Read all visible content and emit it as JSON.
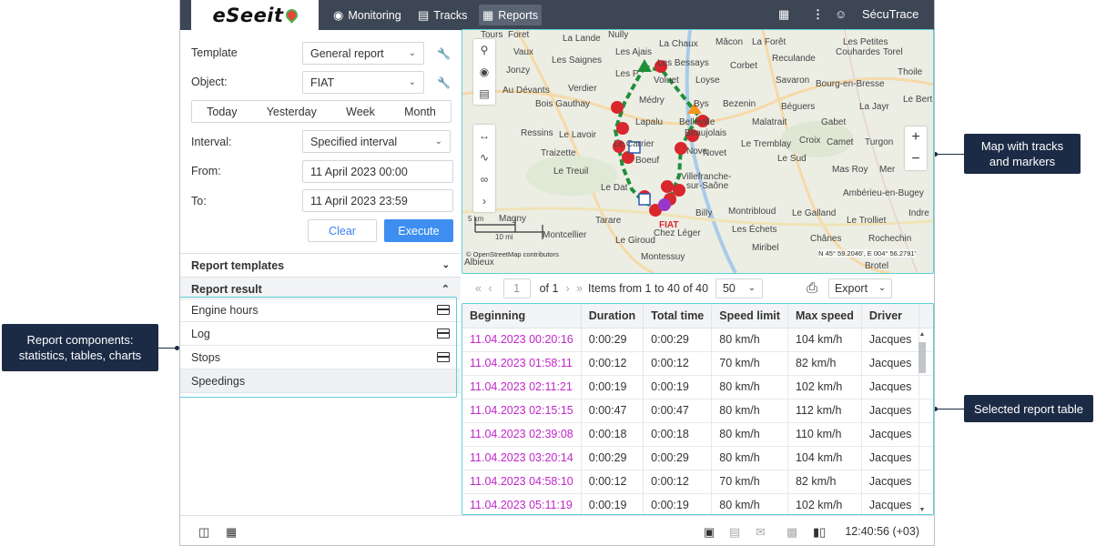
{
  "callouts": {
    "left": "Report components: statistics, tables, charts",
    "map": "Map with tracks and markers",
    "table": "Selected report table"
  },
  "topbar": {
    "logo": "eSeeit",
    "nav": [
      {
        "label": "Monitoring",
        "icon": "globe-icon"
      },
      {
        "label": "Tracks",
        "icon": "tracks-icon"
      },
      {
        "label": "Reports",
        "icon": "reports-icon",
        "active": true
      }
    ],
    "user": "SécuTrace"
  },
  "form": {
    "template_label": "Template",
    "template_value": "General report",
    "object_label": "Object:",
    "object_value": "FIAT",
    "periods": [
      "Today",
      "Yesterday",
      "Week",
      "Month"
    ],
    "interval_label": "Interval:",
    "interval_value": "Specified interval",
    "from_label": "From:",
    "from_value": "11 April 2023 00:00",
    "to_label": "To:",
    "to_value": "11 April 2023 23:59",
    "clear": "Clear",
    "execute": "Execute"
  },
  "sections": {
    "templates": "Report templates",
    "result": "Report result"
  },
  "components": [
    {
      "label": "Engine hours",
      "has_table": true
    },
    {
      "label": "Log",
      "has_table": true
    },
    {
      "label": "Stops",
      "has_table": true
    },
    {
      "label": "Speedings",
      "has_table": false,
      "selected": true
    }
  ],
  "map": {
    "towns": [
      "Tours",
      "Foret",
      "La Lande",
      "Nully",
      "La Chaux",
      "Mâcon",
      "La Forêt",
      "Les Petites",
      "Couhardes",
      "Torel",
      "Vaux",
      "Les Saignes",
      "Les Ajais",
      "Les Bessays",
      "Corbet",
      "Reculande",
      "Thoile",
      "Jonzy",
      "Les P",
      "Voluet",
      "Loyse",
      "Savaron",
      "Bourg-en-Bresse",
      "Au Dévants",
      "Verdier",
      "Le Bert",
      "Bois Gauthay",
      "Médry",
      "Bys",
      "Bezenin",
      "Béguers",
      "La Jayr",
      "Lapalu",
      "Belleville",
      "Malatrait",
      "Gabet",
      "Ressins",
      "Le Lavoir",
      "Beaujolais",
      "Le Tremblay",
      "Croix",
      "Camet",
      "Turgon",
      "Traizette",
      "Le Carrier",
      "Nove",
      "Le Sud",
      "Le Treuil",
      "Boeuf",
      "Novet",
      "Mas Roy",
      "Mer",
      "Le Dat",
      "Villefranche-",
      "sur-Saône",
      "Ambérieu-en-Bugey",
      "Tarare",
      "Billy",
      "Montribloud",
      "Le Galland",
      "Le Trolliet",
      "Indre",
      "Magny",
      "Montcellier",
      "Chez Léger",
      "Les Échets",
      "Chânes",
      "Rochechin",
      "Le Giroud",
      "Montessuy",
      "Miribel",
      "Brotel",
      "Albieux"
    ],
    "vehicle": "FIAT",
    "scale_km": "5 km",
    "scale_mi": "10 mi",
    "copyright": "© OpenStreetMap contributors",
    "coords": "N 45° 59.2046', E 004° 56.2791'",
    "tools": [
      "search-icon",
      "eye-icon",
      "map-layers-icon",
      "ruler-icon",
      "route-icon",
      "geofence-icon",
      "expand-icon"
    ]
  },
  "toolbar": {
    "page": "1",
    "of": "of 1",
    "items": "Items from 1 to 40 of 40",
    "per_page": "50",
    "export": "Export"
  },
  "table": {
    "columns": [
      "Beginning",
      "Duration",
      "Total time",
      "Speed limit",
      "Max speed",
      "Driver"
    ],
    "rows": [
      [
        "11.04.2023 00:20:16",
        "0:00:29",
        "0:00:29",
        "80 km/h",
        "104 km/h",
        "Jacques"
      ],
      [
        "11.04.2023 01:58:11",
        "0:00:12",
        "0:00:12",
        "70 km/h",
        "82 km/h",
        "Jacques"
      ],
      [
        "11.04.2023 02:11:21",
        "0:00:19",
        "0:00:19",
        "80 km/h",
        "102 km/h",
        "Jacques"
      ],
      [
        "11.04.2023 02:15:15",
        "0:00:47",
        "0:00:47",
        "80 km/h",
        "112 km/h",
        "Jacques"
      ],
      [
        "11.04.2023 02:39:08",
        "0:00:18",
        "0:00:18",
        "80 km/h",
        "110 km/h",
        "Jacques"
      ],
      [
        "11.04.2023 03:20:14",
        "0:00:29",
        "0:00:29",
        "80 km/h",
        "104 km/h",
        "Jacques"
      ],
      [
        "11.04.2023 04:58:10",
        "0:00:12",
        "0:00:12",
        "70 km/h",
        "82 km/h",
        "Jacques"
      ],
      [
        "11.04.2023 05:11:19",
        "0:00:19",
        "0:00:19",
        "80 km/h",
        "102 km/h",
        "Jacques"
      ]
    ]
  },
  "footer": {
    "time": "12:40:56 (+03)"
  },
  "colors": {
    "topbar": "#3d4654",
    "accent": "#3d8ef0",
    "link": "#c026c9",
    "highlight": "#5fcfd6",
    "callout": "#1c2b45"
  }
}
